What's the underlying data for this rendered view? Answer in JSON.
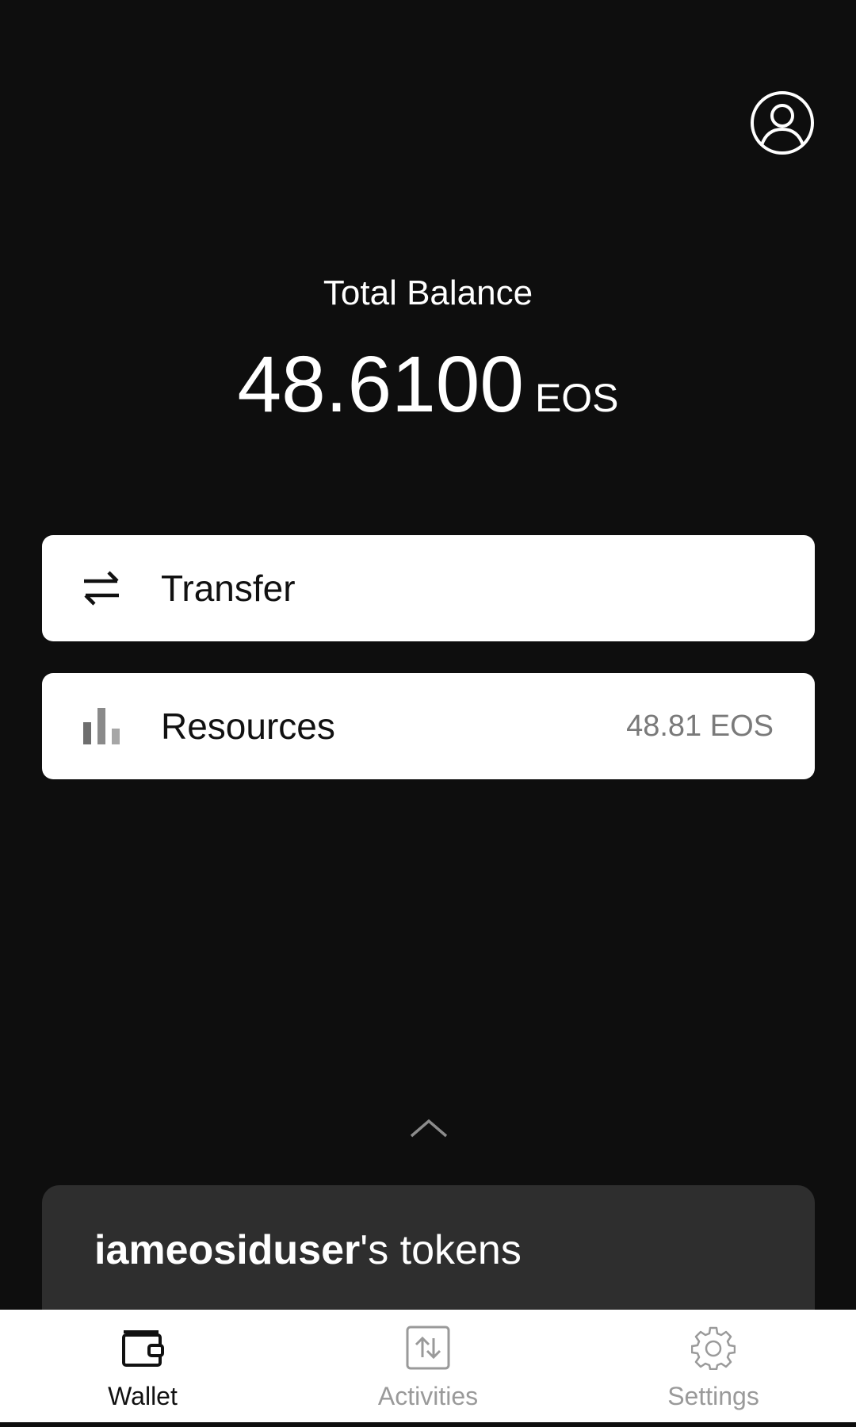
{
  "header": {
    "profile_icon": "user-circle-icon"
  },
  "balance": {
    "label": "Total Balance",
    "amount": "48.6100",
    "unit": "EOS"
  },
  "actions": {
    "transfer": {
      "label": "Transfer",
      "icon": "swap-arrows-icon"
    },
    "resources": {
      "label": "Resources",
      "value": "48.81 EOS",
      "icon": "bar-chart-icon"
    }
  },
  "tokens": {
    "owner": "iameosiduser",
    "suffix": "'s tokens",
    "expand_icon": "chevron-up-icon"
  },
  "nav": {
    "items": [
      {
        "label": "Wallet",
        "icon": "wallet-icon",
        "active": true
      },
      {
        "label": "Activities",
        "icon": "activity-arrows-icon",
        "active": false
      },
      {
        "label": "Settings",
        "icon": "gear-icon",
        "active": false
      }
    ]
  },
  "colors": {
    "background": "#0e0e0e",
    "card": "#ffffff",
    "sheet": "#2e2e2e",
    "muted_text": "#7a7a7a",
    "inactive_nav": "#9a9a9a"
  }
}
